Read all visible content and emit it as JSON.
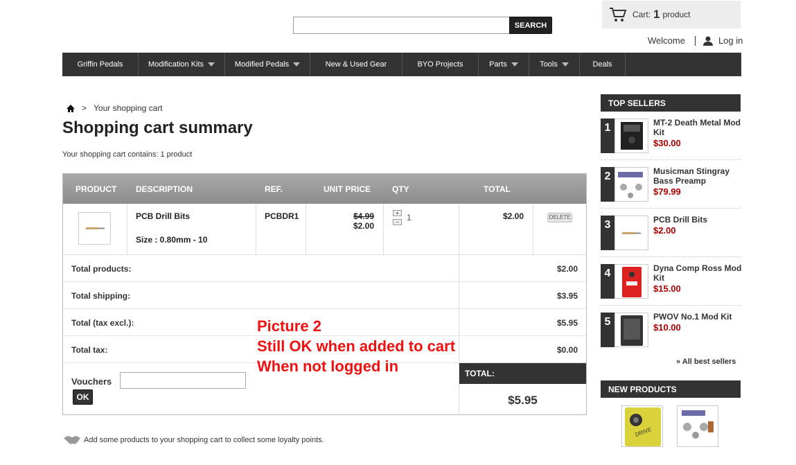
{
  "header": {
    "search": {
      "value": "",
      "placeholder": "",
      "button_label": "SEARCH"
    },
    "cart": {
      "label": "Cart:",
      "count": "1",
      "unit": "product"
    },
    "welcome": "Welcome",
    "login": "Log in"
  },
  "nav": {
    "items": [
      {
        "label": "Griffin Pedals",
        "dropdown": false
      },
      {
        "label": "Modification Kits",
        "dropdown": true
      },
      {
        "label": "Modified Pedals",
        "dropdown": true
      },
      {
        "label": "New & Used Gear",
        "dropdown": false
      },
      {
        "label": "BYO Projects",
        "dropdown": false
      },
      {
        "label": "Parts",
        "dropdown": true
      },
      {
        "label": "Tools",
        "dropdown": true
      },
      {
        "label": "Deals",
        "dropdown": false
      }
    ]
  },
  "breadcrumb": {
    "separator": ">",
    "current": "Your shopping cart"
  },
  "page": {
    "title": "Shopping cart summary",
    "summary": "Your shopping cart contains: 1 product"
  },
  "cart_table": {
    "headers": [
      "PRODUCT",
      "DESCRIPTION",
      "REF.",
      "UNIT PRICE",
      "QTY",
      "TOTAL"
    ],
    "item": {
      "name": "PCB Drill Bits",
      "attributes": "Size : 0.80mm - 10",
      "ref": "PCBDR1",
      "old_price": "$4.99",
      "price": "$2.00",
      "qty": "1",
      "total": "$2.00",
      "delete_label": "DELETE"
    },
    "totals": [
      {
        "label": "Total products:",
        "value": "$2.00"
      },
      {
        "label": "Total shipping:",
        "value": "$3.95"
      },
      {
        "label": "Total (tax excl.):",
        "value": "$5.95"
      },
      {
        "label": "Total tax:",
        "value": "$0.00"
      }
    ],
    "vouchers": {
      "label": "Vouchers",
      "button": "OK"
    },
    "grand_total": {
      "label": "TOTAL:",
      "value": "$5.95"
    }
  },
  "annotation": {
    "line1": "Picture 2",
    "line2": "Still OK when added to cart",
    "line3": "When not logged in",
    "color": "#ee1111"
  },
  "loyalty": "Add some products to your shopping cart to collect some loyalty points.",
  "sidebar": {
    "top_sellers_title": "TOP SELLERS",
    "top_sellers": [
      {
        "rank": "1",
        "name": "MT-2 Death Metal Mod Kit",
        "price": "$30.00"
      },
      {
        "rank": "2",
        "name": "Musicman Stingray Bass Preamp",
        "price": "$79.99"
      },
      {
        "rank": "3",
        "name": "PCB Drill Bits",
        "price": "$2.00"
      },
      {
        "rank": "4",
        "name": "Dyna Comp Ross Mod Kit",
        "price": "$15.00"
      },
      {
        "rank": "5",
        "name": "PWOV No.1 Mod Kit",
        "price": "$10.00"
      }
    ],
    "all_best_sellers": "» All best sellers",
    "new_products_title": "NEW PRODUCTS",
    "new_products_pedal_text": "DRIVE"
  },
  "colors": {
    "nav_bg": "#333333",
    "price_red": "#aa0000",
    "table_header": "#999999"
  }
}
